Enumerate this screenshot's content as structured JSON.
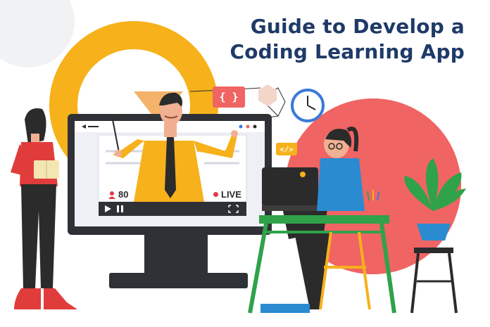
{
  "title": {
    "line1": "Guide to Develop a",
    "line2": "Coding Learning App"
  },
  "video": {
    "viewer_count": "80",
    "live_label": "LIVE"
  },
  "code_badges": {
    "braces": "{ }",
    "tag": "</>"
  },
  "colors": {
    "title": "#1f3a68",
    "accent_red": "#f06463",
    "accent_yellow": "#f6b11b",
    "monitor": "#2f3136"
  }
}
